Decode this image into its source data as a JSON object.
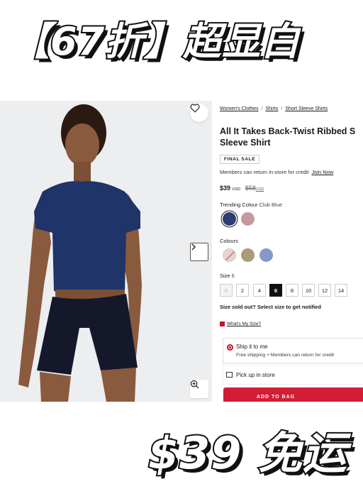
{
  "banner": {
    "top": "【67折】超显白",
    "bottom": "$39 免运"
  },
  "breadcrumbs": [
    "Women's Clothes",
    "Shirts",
    "Short Sleeve Shirts"
  ],
  "product": {
    "title": "All It Takes Back-Twist Ribbed Short Sleeve Shirt",
    "title_line1": "All It Takes Back-Twist Ribbed S",
    "title_line2": "Sleeve Shirt",
    "badge": "FINAL SALE",
    "member_text": "Members can return in-store for credit",
    "join_link": "Join Now",
    "price": "$39",
    "currency": "USD",
    "old_price": "$58",
    "old_currency": "USD"
  },
  "trending": {
    "label": "Trending Colour",
    "value": "Club Blue",
    "swatches": [
      "#2c3e73",
      "#c49aa0"
    ]
  },
  "colours": {
    "label": "Colours",
    "swatches": [
      "#e8d4d0",
      "#a89a7a",
      "#8898c6"
    ]
  },
  "size": {
    "label": "Size",
    "value": "6",
    "options": [
      "0",
      "2",
      "4",
      "6",
      "8",
      "10",
      "12",
      "14"
    ],
    "selected": "6",
    "sold_out": [
      "0"
    ],
    "sold_out_text": "Size sold out? Select size to get notified",
    "guide_link": "What's My Size?"
  },
  "shipping": {
    "ship_title": "Ship it to me",
    "ship_sub": "Free shipping + Members can return for credit",
    "pickup": "Pick up in store"
  },
  "cta": {
    "add_to_bag": "ADD TO BAG"
  },
  "colors": {
    "accent": "#d31c35",
    "selected_size": "#111111"
  },
  "icons": {
    "wishlist": "heart-icon",
    "next": "chevron-right-icon",
    "zoom": "zoom-in-icon"
  }
}
